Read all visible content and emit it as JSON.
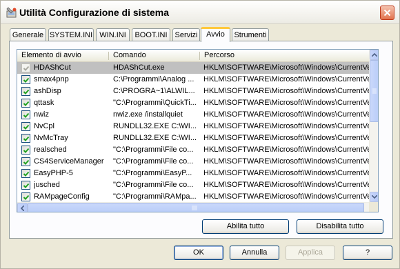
{
  "window": {
    "title": "Utilità Configurazione di sistema"
  },
  "tabs": [
    {
      "label": "Generale"
    },
    {
      "label": "SYSTEM.INI"
    },
    {
      "label": "WIN.INI"
    },
    {
      "label": "BOOT.INI"
    },
    {
      "label": "Servizi"
    },
    {
      "label": "Avvio",
      "selected": true
    },
    {
      "label": "Strumenti"
    }
  ],
  "list": {
    "headers": [
      "Elemento di avvio",
      "Comando",
      "Percorso"
    ],
    "rows": [
      {
        "checked": true,
        "disabled": true,
        "item": "HDAShCut",
        "command": "HDAShCut.exe",
        "path": "HKLM\\SOFTWARE\\Microsoft\\Windows\\CurrentVer..."
      },
      {
        "checked": true,
        "item": "smax4pnp",
        "command": "C:\\Programmi\\Analog ...",
        "path": "HKLM\\SOFTWARE\\Microsoft\\Windows\\CurrentVer..."
      },
      {
        "checked": true,
        "item": "ashDisp",
        "command": "C:\\PROGRA~1\\ALWIL...",
        "path": "HKLM\\SOFTWARE\\Microsoft\\Windows\\CurrentVer..."
      },
      {
        "checked": true,
        "item": "qttask",
        "command": "\"C:\\Programmi\\QuickTi...",
        "path": "HKLM\\SOFTWARE\\Microsoft\\Windows\\CurrentVer..."
      },
      {
        "checked": true,
        "item": "nwiz",
        "command": "nwiz.exe /installquiet",
        "path": "HKLM\\SOFTWARE\\Microsoft\\Windows\\CurrentVer..."
      },
      {
        "checked": true,
        "item": "NvCpl",
        "command": "RUNDLL32.EXE C:\\WI...",
        "path": "HKLM\\SOFTWARE\\Microsoft\\Windows\\CurrentVer..."
      },
      {
        "checked": true,
        "item": "NvMcTray",
        "command": "RUNDLL32.EXE C:\\WI...",
        "path": "HKLM\\SOFTWARE\\Microsoft\\Windows\\CurrentVer..."
      },
      {
        "checked": true,
        "item": "realsched",
        "command": "\"C:\\Programmi\\File co...",
        "path": "HKLM\\SOFTWARE\\Microsoft\\Windows\\CurrentVer..."
      },
      {
        "checked": true,
        "item": "CS4ServiceManager",
        "command": "\"C:\\Programmi\\File co...",
        "path": "HKLM\\SOFTWARE\\Microsoft\\Windows\\CurrentVer..."
      },
      {
        "checked": true,
        "item": "EasyPHP-5",
        "command": "\"C:\\Programmi\\EasyP...",
        "path": "HKLM\\SOFTWARE\\Microsoft\\Windows\\CurrentVer..."
      },
      {
        "checked": true,
        "item": "jusched",
        "command": "\"C:\\Programmi\\File co...",
        "path": "HKLM\\SOFTWARE\\Microsoft\\Windows\\CurrentVer..."
      },
      {
        "checked": true,
        "item": "RAMpageConfig",
        "command": "\"C:\\Programmi\\RAMpa...",
        "path": "HKLM\\SOFTWARE\\Microsoft\\Windows\\CurrentVer..."
      }
    ]
  },
  "actions": {
    "enable_all": "Abilita tutto",
    "disable_all": "Disabilita tutto"
  },
  "dialog": {
    "ok": "OK",
    "cancel": "Annulla",
    "apply": "Applica",
    "help": "?"
  },
  "colors": {
    "selection": "#c0c0c0",
    "check": "#21a121",
    "titlebar_close": "#e2734d"
  }
}
